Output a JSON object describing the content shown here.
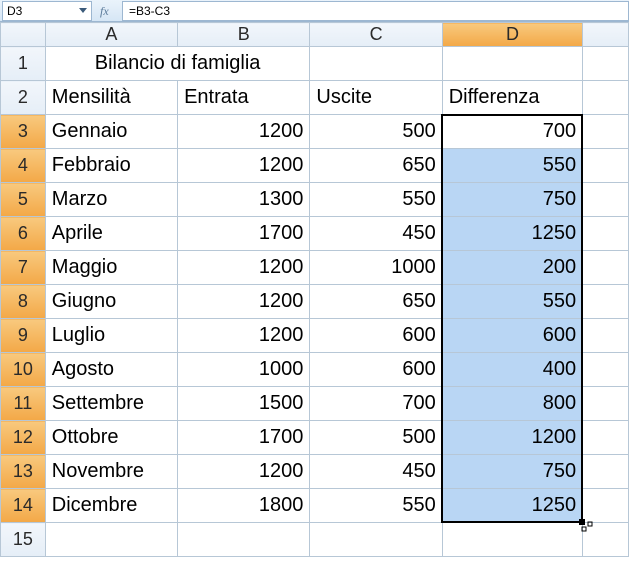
{
  "formula_bar": {
    "cell_ref": "D3",
    "formula": "=B3-C3"
  },
  "columns": [
    "A",
    "B",
    "C",
    "D"
  ],
  "selected_column": "D",
  "row_headers": [
    1,
    2,
    3,
    4,
    5,
    6,
    7,
    8,
    9,
    10,
    11,
    12,
    13,
    14,
    15
  ],
  "selected_row_headers": [
    3,
    4,
    5,
    6,
    7,
    8,
    9,
    10,
    11,
    12,
    13,
    14
  ],
  "title_cell": "Bilancio di famiglia",
  "headers": {
    "A": "Mensilità",
    "B": "Entrata",
    "C": "Uscite",
    "D": "Differenza"
  },
  "rows": [
    {
      "A": "Gennaio",
      "B": 1200,
      "C": 500,
      "D": 700
    },
    {
      "A": "Febbraio",
      "B": 1200,
      "C": 650,
      "D": 550
    },
    {
      "A": "Marzo",
      "B": 1300,
      "C": 550,
      "D": 750
    },
    {
      "A": "Aprile",
      "B": 1700,
      "C": 450,
      "D": 1250
    },
    {
      "A": "Maggio",
      "B": 1200,
      "C": 1000,
      "D": 200
    },
    {
      "A": "Giugno",
      "B": 1200,
      "C": 650,
      "D": 550
    },
    {
      "A": "Luglio",
      "B": 1200,
      "C": 600,
      "D": 600
    },
    {
      "A": "Agosto",
      "B": 1000,
      "C": 600,
      "D": 400
    },
    {
      "A": "Settembre",
      "B": 1500,
      "C": 700,
      "D": 800
    },
    {
      "A": "Ottobre",
      "B": 1700,
      "C": 500,
      "D": 1200
    },
    {
      "A": "Novembre",
      "B": 1200,
      "C": 450,
      "D": 750
    },
    {
      "A": "Dicembre",
      "B": 1800,
      "C": 550,
      "D": 1250
    }
  ],
  "chart_data": {
    "type": "table",
    "title": "Bilancio di famiglia",
    "columns": [
      "Mensilità",
      "Entrata",
      "Uscite",
      "Differenza"
    ],
    "rows": [
      [
        "Gennaio",
        1200,
        500,
        700
      ],
      [
        "Febbraio",
        1200,
        650,
        550
      ],
      [
        "Marzo",
        1300,
        550,
        750
      ],
      [
        "Aprile",
        1700,
        450,
        1250
      ],
      [
        "Maggio",
        1200,
        1000,
        200
      ],
      [
        "Giugno",
        1200,
        650,
        550
      ],
      [
        "Luglio",
        1200,
        600,
        600
      ],
      [
        "Agosto",
        1000,
        600,
        400
      ],
      [
        "Settembre",
        1500,
        700,
        800
      ],
      [
        "Ottobre",
        1700,
        500,
        1200
      ],
      [
        "Novembre",
        1200,
        450,
        750
      ],
      [
        "Dicembre",
        1800,
        550,
        1250
      ]
    ]
  }
}
